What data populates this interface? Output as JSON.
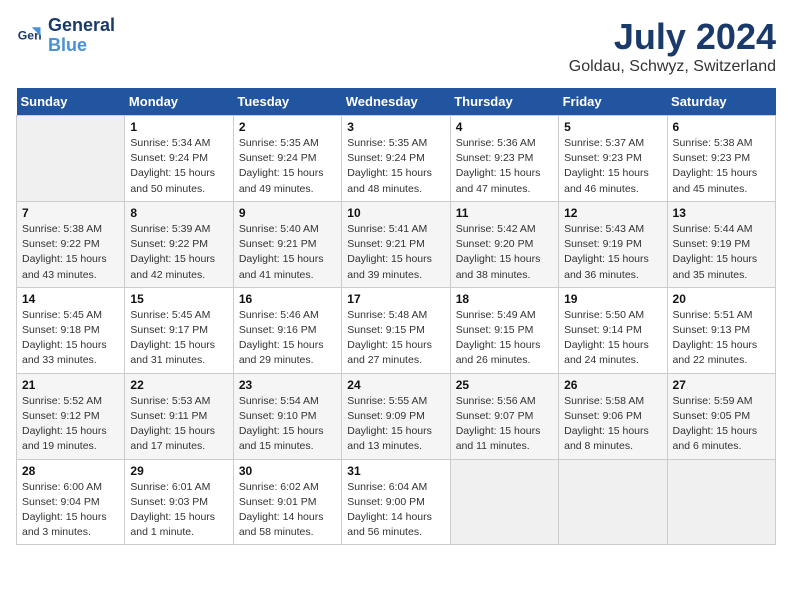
{
  "header": {
    "logo_line1": "General",
    "logo_line2": "Blue",
    "month": "July 2024",
    "location": "Goldau, Schwyz, Switzerland"
  },
  "days_of_week": [
    "Sunday",
    "Monday",
    "Tuesday",
    "Wednesday",
    "Thursday",
    "Friday",
    "Saturday"
  ],
  "weeks": [
    [
      {
        "day": "",
        "sunrise": "",
        "sunset": "",
        "daylight": ""
      },
      {
        "day": "1",
        "sunrise": "Sunrise: 5:34 AM",
        "sunset": "Sunset: 9:24 PM",
        "daylight": "Daylight: 15 hours and 50 minutes."
      },
      {
        "day": "2",
        "sunrise": "Sunrise: 5:35 AM",
        "sunset": "Sunset: 9:24 PM",
        "daylight": "Daylight: 15 hours and 49 minutes."
      },
      {
        "day": "3",
        "sunrise": "Sunrise: 5:35 AM",
        "sunset": "Sunset: 9:24 PM",
        "daylight": "Daylight: 15 hours and 48 minutes."
      },
      {
        "day": "4",
        "sunrise": "Sunrise: 5:36 AM",
        "sunset": "Sunset: 9:23 PM",
        "daylight": "Daylight: 15 hours and 47 minutes."
      },
      {
        "day": "5",
        "sunrise": "Sunrise: 5:37 AM",
        "sunset": "Sunset: 9:23 PM",
        "daylight": "Daylight: 15 hours and 46 minutes."
      },
      {
        "day": "6",
        "sunrise": "Sunrise: 5:38 AM",
        "sunset": "Sunset: 9:23 PM",
        "daylight": "Daylight: 15 hours and 45 minutes."
      }
    ],
    [
      {
        "day": "7",
        "sunrise": "Sunrise: 5:38 AM",
        "sunset": "Sunset: 9:22 PM",
        "daylight": "Daylight: 15 hours and 43 minutes."
      },
      {
        "day": "8",
        "sunrise": "Sunrise: 5:39 AM",
        "sunset": "Sunset: 9:22 PM",
        "daylight": "Daylight: 15 hours and 42 minutes."
      },
      {
        "day": "9",
        "sunrise": "Sunrise: 5:40 AM",
        "sunset": "Sunset: 9:21 PM",
        "daylight": "Daylight: 15 hours and 41 minutes."
      },
      {
        "day": "10",
        "sunrise": "Sunrise: 5:41 AM",
        "sunset": "Sunset: 9:21 PM",
        "daylight": "Daylight: 15 hours and 39 minutes."
      },
      {
        "day": "11",
        "sunrise": "Sunrise: 5:42 AM",
        "sunset": "Sunset: 9:20 PM",
        "daylight": "Daylight: 15 hours and 38 minutes."
      },
      {
        "day": "12",
        "sunrise": "Sunrise: 5:43 AM",
        "sunset": "Sunset: 9:19 PM",
        "daylight": "Daylight: 15 hours and 36 minutes."
      },
      {
        "day": "13",
        "sunrise": "Sunrise: 5:44 AM",
        "sunset": "Sunset: 9:19 PM",
        "daylight": "Daylight: 15 hours and 35 minutes."
      }
    ],
    [
      {
        "day": "14",
        "sunrise": "Sunrise: 5:45 AM",
        "sunset": "Sunset: 9:18 PM",
        "daylight": "Daylight: 15 hours and 33 minutes."
      },
      {
        "day": "15",
        "sunrise": "Sunrise: 5:45 AM",
        "sunset": "Sunset: 9:17 PM",
        "daylight": "Daylight: 15 hours and 31 minutes."
      },
      {
        "day": "16",
        "sunrise": "Sunrise: 5:46 AM",
        "sunset": "Sunset: 9:16 PM",
        "daylight": "Daylight: 15 hours and 29 minutes."
      },
      {
        "day": "17",
        "sunrise": "Sunrise: 5:48 AM",
        "sunset": "Sunset: 9:15 PM",
        "daylight": "Daylight: 15 hours and 27 minutes."
      },
      {
        "day": "18",
        "sunrise": "Sunrise: 5:49 AM",
        "sunset": "Sunset: 9:15 PM",
        "daylight": "Daylight: 15 hours and 26 minutes."
      },
      {
        "day": "19",
        "sunrise": "Sunrise: 5:50 AM",
        "sunset": "Sunset: 9:14 PM",
        "daylight": "Daylight: 15 hours and 24 minutes."
      },
      {
        "day": "20",
        "sunrise": "Sunrise: 5:51 AM",
        "sunset": "Sunset: 9:13 PM",
        "daylight": "Daylight: 15 hours and 22 minutes."
      }
    ],
    [
      {
        "day": "21",
        "sunrise": "Sunrise: 5:52 AM",
        "sunset": "Sunset: 9:12 PM",
        "daylight": "Daylight: 15 hours and 19 minutes."
      },
      {
        "day": "22",
        "sunrise": "Sunrise: 5:53 AM",
        "sunset": "Sunset: 9:11 PM",
        "daylight": "Daylight: 15 hours and 17 minutes."
      },
      {
        "day": "23",
        "sunrise": "Sunrise: 5:54 AM",
        "sunset": "Sunset: 9:10 PM",
        "daylight": "Daylight: 15 hours and 15 minutes."
      },
      {
        "day": "24",
        "sunrise": "Sunrise: 5:55 AM",
        "sunset": "Sunset: 9:09 PM",
        "daylight": "Daylight: 15 hours and 13 minutes."
      },
      {
        "day": "25",
        "sunrise": "Sunrise: 5:56 AM",
        "sunset": "Sunset: 9:07 PM",
        "daylight": "Daylight: 15 hours and 11 minutes."
      },
      {
        "day": "26",
        "sunrise": "Sunrise: 5:58 AM",
        "sunset": "Sunset: 9:06 PM",
        "daylight": "Daylight: 15 hours and 8 minutes."
      },
      {
        "day": "27",
        "sunrise": "Sunrise: 5:59 AM",
        "sunset": "Sunset: 9:05 PM",
        "daylight": "Daylight: 15 hours and 6 minutes."
      }
    ],
    [
      {
        "day": "28",
        "sunrise": "Sunrise: 6:00 AM",
        "sunset": "Sunset: 9:04 PM",
        "daylight": "Daylight: 15 hours and 3 minutes."
      },
      {
        "day": "29",
        "sunrise": "Sunrise: 6:01 AM",
        "sunset": "Sunset: 9:03 PM",
        "daylight": "Daylight: 15 hours and 1 minute."
      },
      {
        "day": "30",
        "sunrise": "Sunrise: 6:02 AM",
        "sunset": "Sunset: 9:01 PM",
        "daylight": "Daylight: 14 hours and 58 minutes."
      },
      {
        "day": "31",
        "sunrise": "Sunrise: 6:04 AM",
        "sunset": "Sunset: 9:00 PM",
        "daylight": "Daylight: 14 hours and 56 minutes."
      },
      {
        "day": "",
        "sunrise": "",
        "sunset": "",
        "daylight": ""
      },
      {
        "day": "",
        "sunrise": "",
        "sunset": "",
        "daylight": ""
      },
      {
        "day": "",
        "sunrise": "",
        "sunset": "",
        "daylight": ""
      }
    ]
  ]
}
